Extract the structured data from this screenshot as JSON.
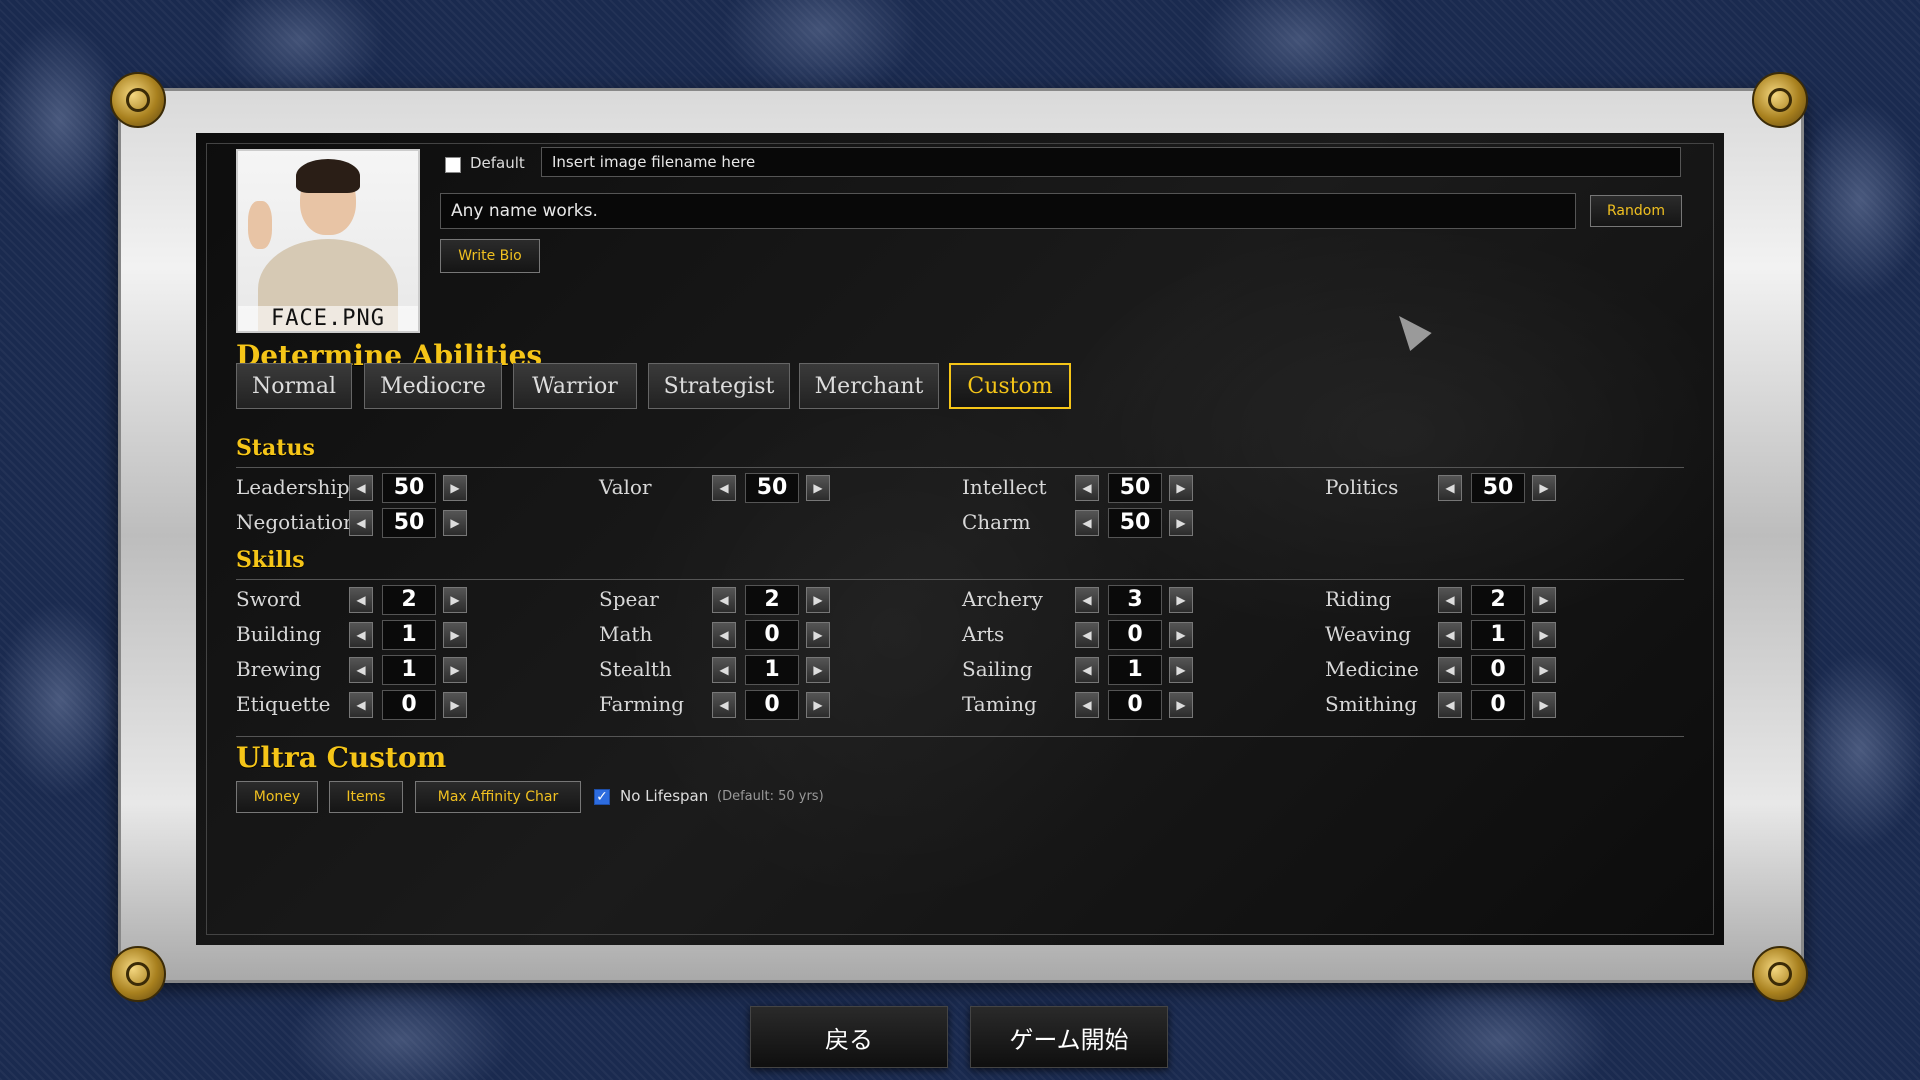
{
  "profile": {
    "portrait_label": "FACE.PNG",
    "default_label": "Default",
    "default_checked": false,
    "image_filename_placeholder": "Insert image filename here",
    "name_value": "Any name works.",
    "random_label": "Random",
    "write_bio_label": "Write Bio"
  },
  "abilities": {
    "heading": "Determine Abilities",
    "presets": [
      "Normal",
      "Mediocre",
      "Warrior",
      "Strategist",
      "Merchant",
      "Custom"
    ],
    "active_preset": "Custom"
  },
  "status": {
    "heading": "Status",
    "items": [
      {
        "label": "Leadership",
        "value": "50"
      },
      {
        "label": "Valor",
        "value": "50"
      },
      {
        "label": "Intellect",
        "value": "50"
      },
      {
        "label": "Politics",
        "value": "50"
      },
      {
        "label": "Negotiation",
        "value": "50"
      },
      {
        "label": "Charm",
        "value": "50"
      }
    ]
  },
  "skills": {
    "heading": "Skills",
    "items": [
      {
        "label": "Sword",
        "value": "2"
      },
      {
        "label": "Spear",
        "value": "2"
      },
      {
        "label": "Archery",
        "value": "3"
      },
      {
        "label": "Riding",
        "value": "2"
      },
      {
        "label": "Building",
        "value": "1"
      },
      {
        "label": "Math",
        "value": "0"
      },
      {
        "label": "Arts",
        "value": "0"
      },
      {
        "label": "Weaving",
        "value": "1"
      },
      {
        "label": "Brewing",
        "value": "1"
      },
      {
        "label": "Stealth",
        "value": "1"
      },
      {
        "label": "Sailing",
        "value": "1"
      },
      {
        "label": "Medicine",
        "value": "0"
      },
      {
        "label": "Etiquette",
        "value": "0"
      },
      {
        "label": "Farming",
        "value": "0"
      },
      {
        "label": "Taming",
        "value": "0"
      },
      {
        "label": "Smithing",
        "value": "0"
      }
    ]
  },
  "ultra": {
    "heading": "Ultra Custom",
    "money_label": "Money",
    "items_label": "Items",
    "affinity_label": "Max Affinity Char",
    "no_lifespan_label": "No Lifespan",
    "no_lifespan_checked": true,
    "no_lifespan_note": "(Default: 50 yrs)"
  },
  "footer": {
    "back_label": "戻る",
    "start_label": "ゲーム開始"
  },
  "icons": {
    "left_arrow": "◀",
    "right_arrow": "▶",
    "check": "✓"
  },
  "colors": {
    "accent_gold": "#f5c518",
    "background_navy": "#1a2a4f"
  }
}
